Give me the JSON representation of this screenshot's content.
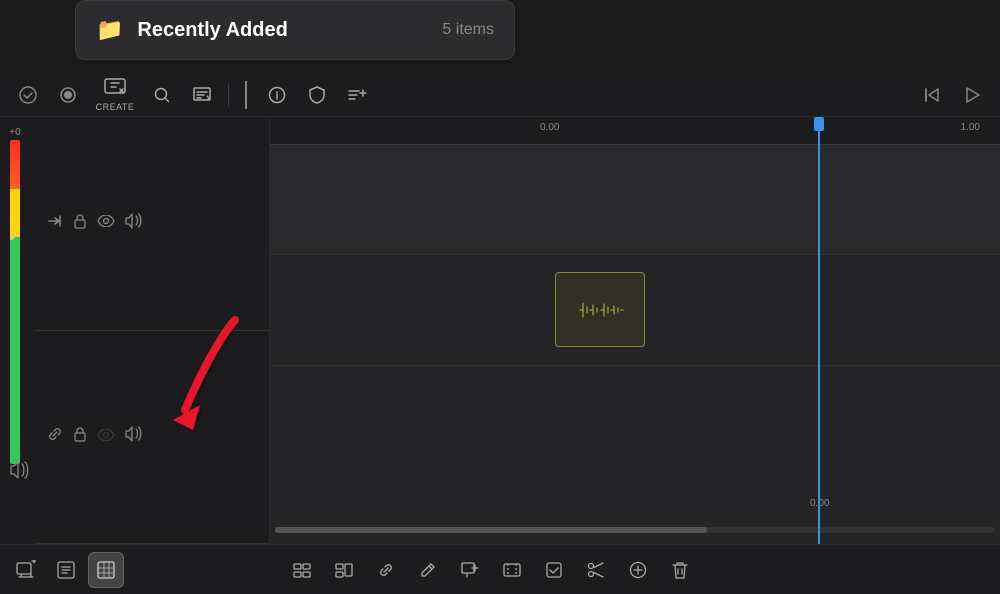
{
  "panel": {
    "title": "Recently Added",
    "count": "5 items",
    "folder_icon": "📁"
  },
  "toolbar": {
    "check_label": "✓",
    "record_label": "⏺",
    "create_label": "CREATE",
    "search_label": "🔍",
    "list_label": "≡",
    "info_label": "ⓘ",
    "shield_label": "🛡",
    "add_track_label": "⊕",
    "skip_back_label": "⏮",
    "play_label": "▶"
  },
  "timeline": {
    "time_0": "0.00",
    "time_1": "1.00",
    "playhead_pos": "0.00"
  },
  "track_controls": {
    "row1": {
      "follow": "→|",
      "lock": "🔒",
      "eye": "👁",
      "speaker": "🔊"
    },
    "row2": {
      "link": "🔗",
      "lock": "🔒",
      "eye_muted": "👁",
      "speaker": "🔊"
    }
  },
  "bottom_toolbar": {
    "add_media": "⊞",
    "list_view": "≣",
    "grid_view": "▦",
    "link": "🔗",
    "edit": "✏",
    "transform": "⧉",
    "trim": "⊟",
    "checkbox": "☑",
    "scissors": "✂",
    "add_circle": "⊕",
    "trash": "🗑"
  },
  "vu": {
    "label": "+0"
  }
}
